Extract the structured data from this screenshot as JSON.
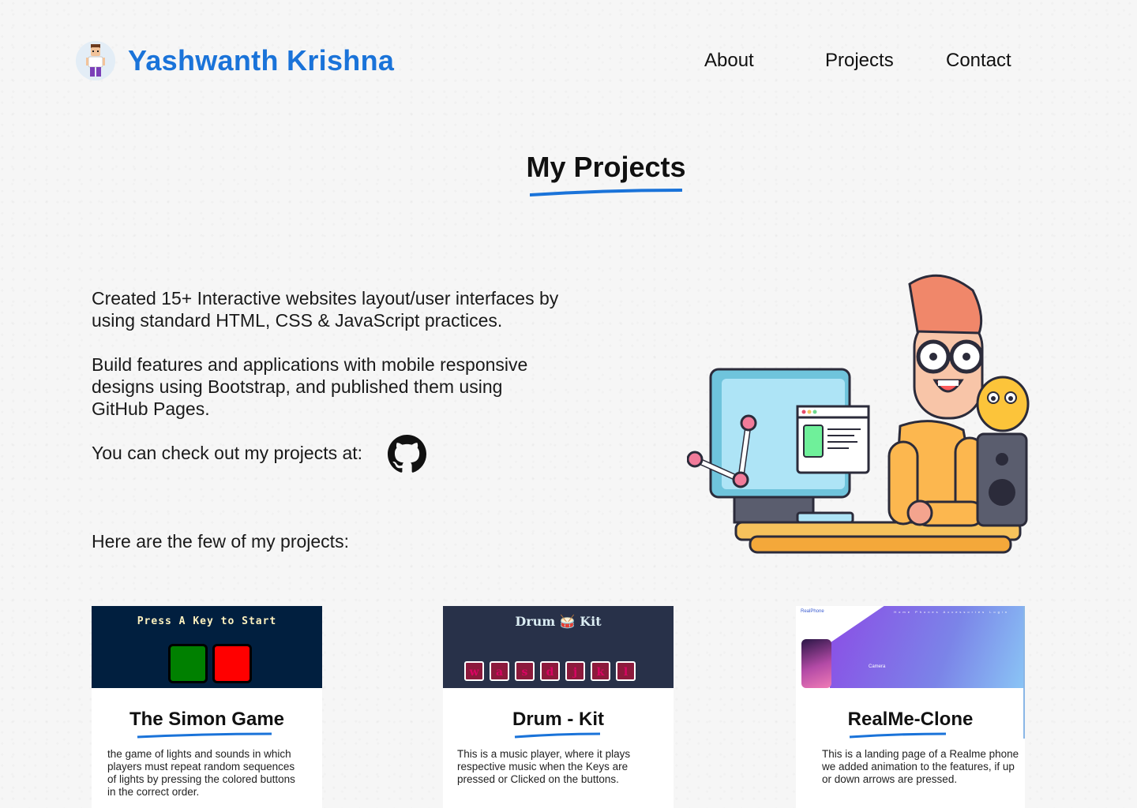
{
  "header": {
    "brand": "Yashwanth Krishna",
    "nav": [
      {
        "label": "About"
      },
      {
        "label": "Projects"
      },
      {
        "label": "Contact"
      }
    ]
  },
  "main": {
    "title": "My Projects",
    "paragraphs": [
      "Created 15+ Interactive websites layout/user interfaces by using standard HTML, CSS & JavaScript practices.",
      "Build features and applications with mobile responsive designs using Bootstrap, and published them using GitHub Pages.",
      "You can check out my projects at:",
      "Here are the few of my projects:"
    ]
  },
  "cards": [
    {
      "title": "The Simon Game",
      "description": "the game of lights and sounds in which players must repeat random sequences of lights by pressing the colored buttons in the correct order.",
      "thumb_heading": "Press A Key to Start"
    },
    {
      "title": "Drum - Kit",
      "description": "This is a music player, where it plays respective music when the Keys are pressed or Clicked on the buttons.",
      "thumb_heading": "Drum 🥁 Kit",
      "keys": [
        "w",
        "a",
        "s",
        "d",
        "j",
        "k",
        "l"
      ]
    },
    {
      "title": "RealMe-Clone",
      "description": "This is a landing page of a Realme phone we added animation to the features, if up or down arrows are pressed.",
      "thumb_logo": "RealPhone",
      "thumb_nav": "Home Phones Accessories Login",
      "thumb_feature": "Camera"
    }
  ],
  "colors": {
    "accent": "#1a73d9",
    "simon_bg": "#011f3f",
    "drum_bg": "#283149"
  },
  "icons": {
    "github": "github-icon"
  }
}
